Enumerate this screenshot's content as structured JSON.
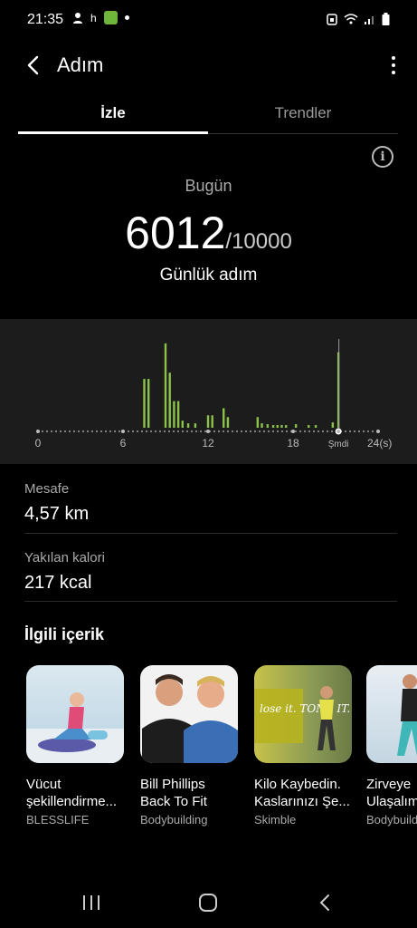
{
  "status_bar": {
    "time": "21:35",
    "letter": "h"
  },
  "app_bar": {
    "title": "Adım"
  },
  "tabs": [
    {
      "label": "İzle",
      "active": true
    },
    {
      "label": "Trendler",
      "active": false
    }
  ],
  "summary": {
    "today_label": "Bugün",
    "steps": "6012",
    "goal": "/10000",
    "caption": "Günlük adım"
  },
  "chart_data": {
    "type": "bar",
    "x_ticks": [
      "0",
      "6",
      "12",
      "18",
      "Şmdi",
      "24(s)"
    ],
    "x": [
      7.5,
      7.8,
      9.0,
      9.3,
      9.6,
      9.9,
      10.2,
      10.6,
      11.1,
      12.0,
      12.3,
      13.1,
      13.4,
      15.5,
      15.8,
      16.2,
      16.6,
      16.9,
      17.2,
      17.5,
      18.2,
      19.1,
      19.6,
      20.8,
      21.2
    ],
    "values": [
      55,
      55,
      95,
      62,
      30,
      30,
      8,
      5,
      5,
      14,
      14,
      22,
      12,
      12,
      5,
      4,
      3,
      3,
      3,
      3,
      4,
      3,
      3,
      6,
      85
    ],
    "xlim": [
      0,
      24
    ],
    "now_marker": 21.2,
    "bar_color": "#8bc34a"
  },
  "stats": [
    {
      "label": "Mesafe",
      "value": "4,57 km"
    },
    {
      "label": "Yakılan kalori",
      "value": "217 kcal"
    }
  ],
  "related": {
    "title": "İlgili içerik",
    "cards": [
      {
        "title": "Vücut",
        "title2": "şekillendirme...",
        "source": "BLESSLIFE"
      },
      {
        "title": "Bill Phillips",
        "title2": "Back To Fit",
        "source": "Bodybuilding"
      },
      {
        "title": "Kilo Kaybedin.",
        "title2": "Kaslarınızı Şe...",
        "source": "Skimble",
        "thumb_text": "lose it. TONE IT."
      },
      {
        "title": "Zirveye",
        "title2": "Ulaşalım",
        "source": "Bodybuilding"
      }
    ]
  }
}
